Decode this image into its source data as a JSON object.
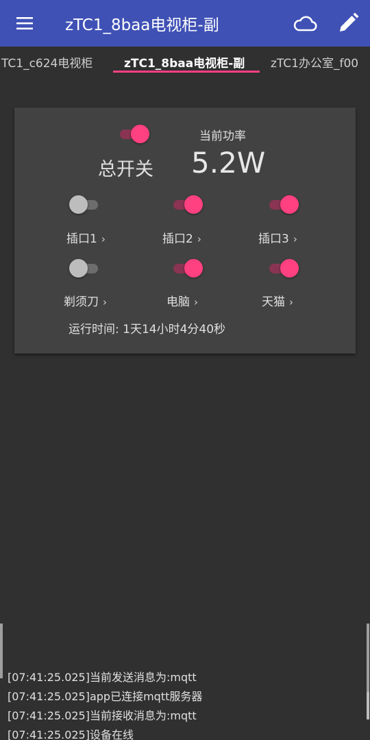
{
  "appbar": {
    "title": "zTC1_8baa电视柜-副",
    "menu_icon": "menu-icon",
    "cloud_icon": "cloud-icon",
    "edit_icon": "edit-icon"
  },
  "tabs": [
    {
      "label": "TC1_c624电视柜",
      "active": false
    },
    {
      "label": "zTC1_8baa电视柜-副",
      "active": true
    },
    {
      "label": "zTC1办公室_f00",
      "active": false
    }
  ],
  "colors": {
    "primary": "#3f51b5",
    "accent": "#ff4081",
    "background": "#303030",
    "card": "#424242"
  },
  "device": {
    "master_label": "总开关",
    "master_on": true,
    "power_label": "当前功率",
    "power_value": "5.2W",
    "sockets": [
      {
        "label": "插口1",
        "on": false
      },
      {
        "label": "插口2",
        "on": true
      },
      {
        "label": "插口3",
        "on": true
      },
      {
        "label": "剃须刀",
        "on": false
      },
      {
        "label": "电脑",
        "on": true
      },
      {
        "label": "天猫",
        "on": true
      }
    ],
    "chevron": "›",
    "runtime": "运行时间: 1天14小时4分40秒"
  },
  "log": [
    "[07:41:25.025]当前发送消息为:mqtt",
    "[07:41:25.025]app已连接mqtt服务器",
    "[07:41:25.025]当前接收消息为:mqtt",
    "[07:41:25.025]设备在线"
  ]
}
